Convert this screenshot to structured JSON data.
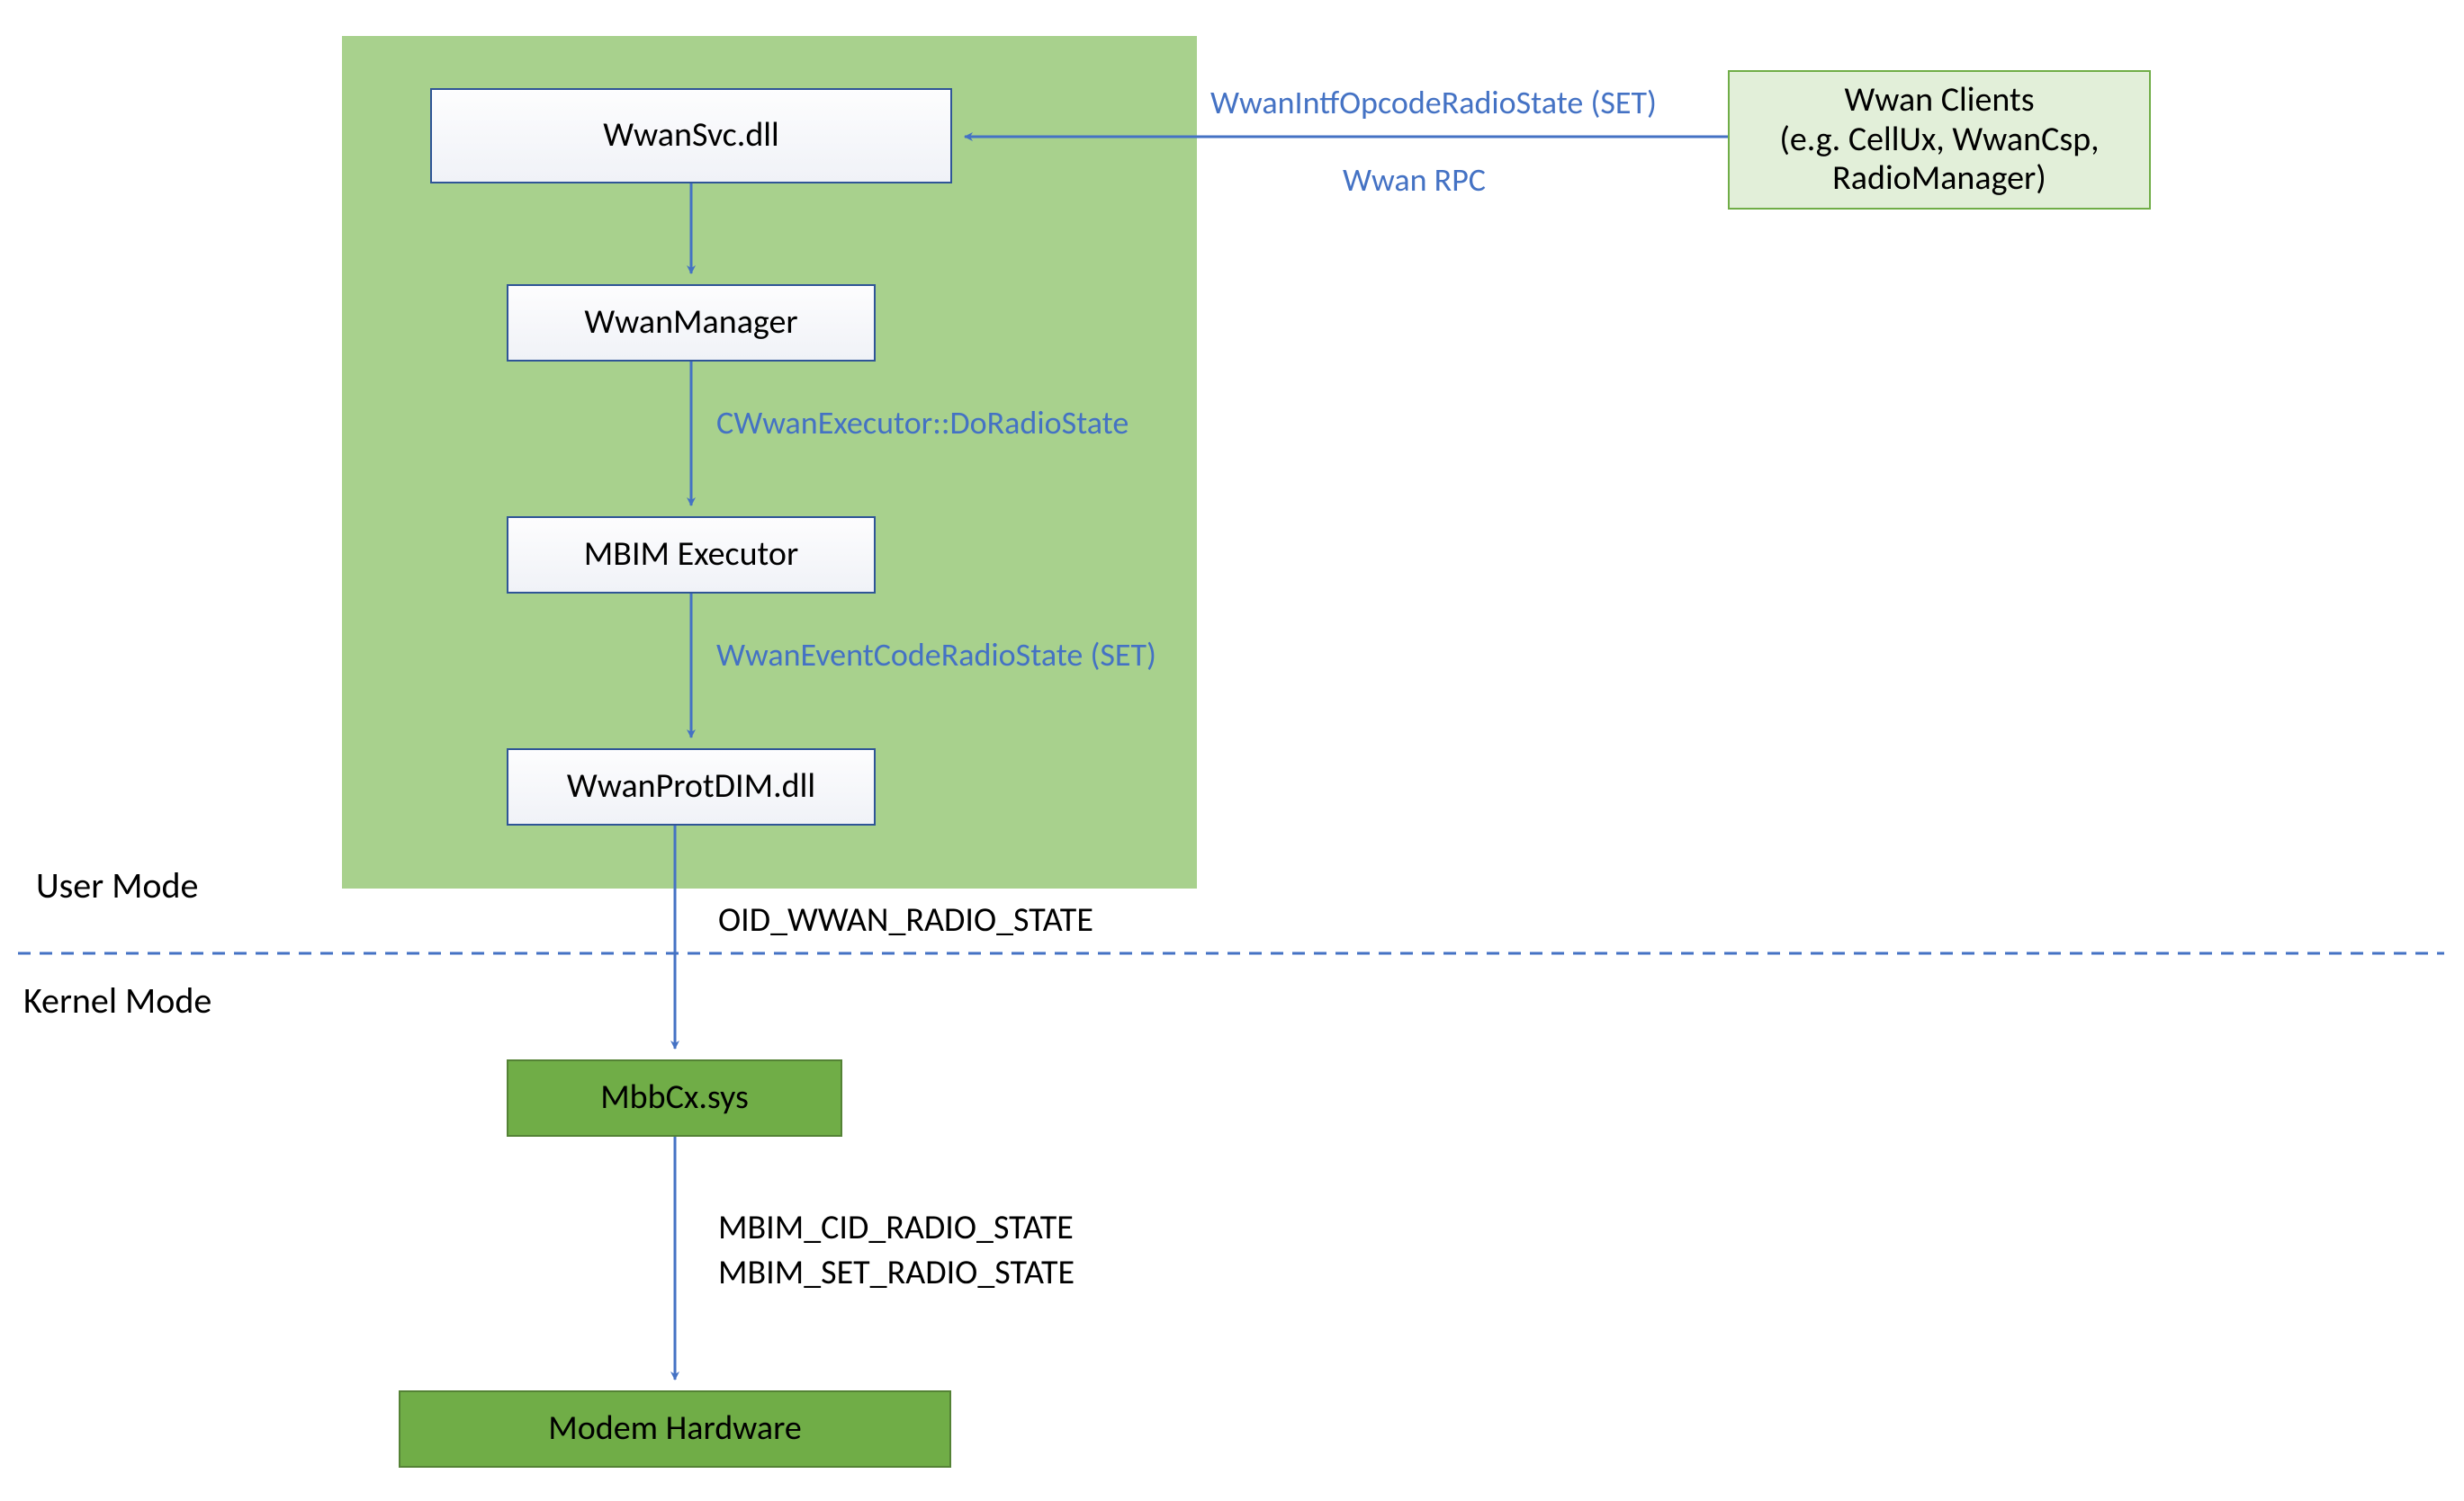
{
  "boxes": {
    "wwansvc": "WwanSvc.dll",
    "wwanmanager": "WwanManager",
    "mbimexecutor": "MBIM Executor",
    "wwanprotdim": "WwanProtDIM.dll",
    "mbbcx": "MbbCx.sys",
    "modem": "Modem Hardware",
    "clients_line1": "Wwan Clients",
    "clients_line2": "(e.g. CellUx, WwanCsp,",
    "clients_line3": "RadioManager)"
  },
  "labels": {
    "rpc_top": "WwanIntfOpcodeRadioState (SET)",
    "rpc_bottom": "Wwan RPC",
    "executor_call": "CWwanExecutor::DoRadioState",
    "event_code": "WwanEventCodeRadioState (SET)",
    "oid": "OID_WWAN_RADIO_STATE",
    "mbim_line1": "MBIM_CID_RADIO_STATE",
    "mbim_line2": "MBIM_SET_RADIO_STATE",
    "user_mode": "User Mode",
    "kernel_mode": "Kernel Mode"
  },
  "colors": {
    "arrow": "#4472c4",
    "dash": "#4472c4"
  }
}
